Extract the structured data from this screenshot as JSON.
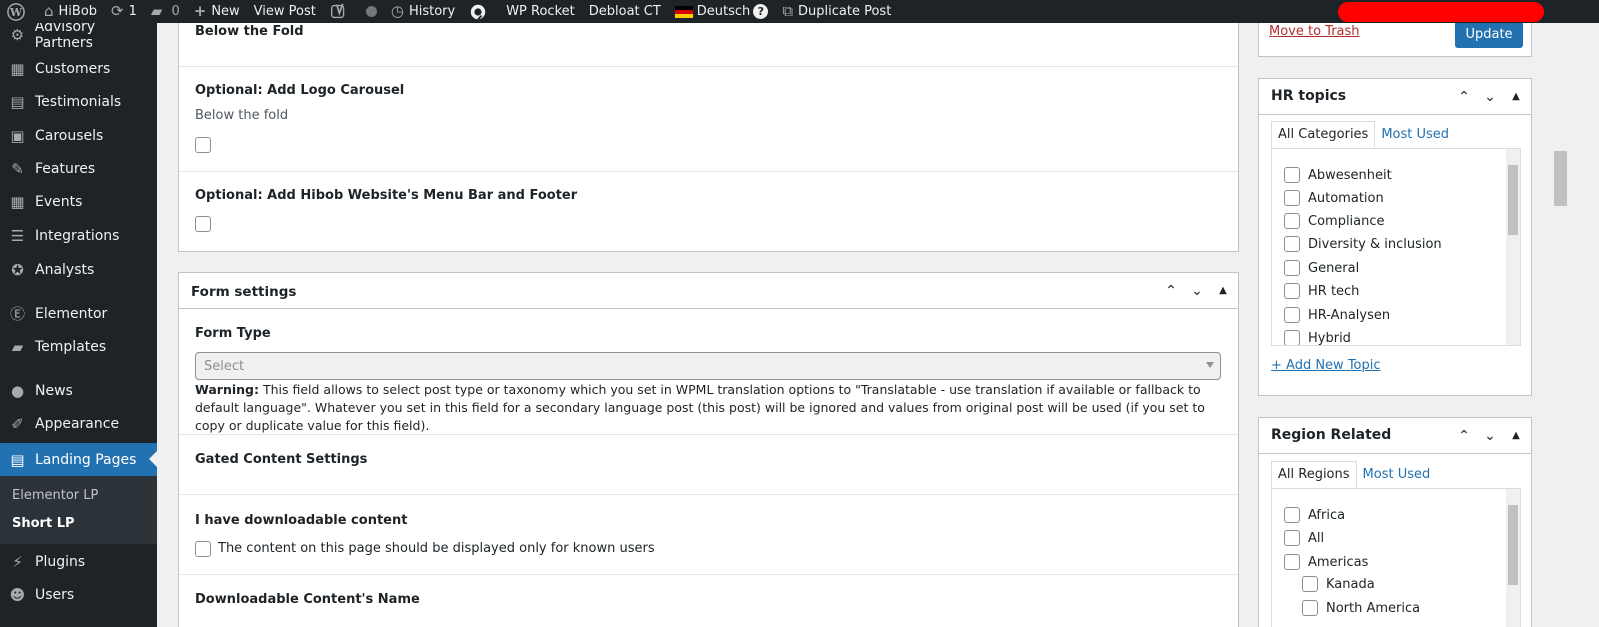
{
  "adminbar": {
    "site_name": "HiBob",
    "updates_count": "1",
    "comments_count": "0",
    "new_label": "New",
    "view_post": "View Post",
    "history": "History",
    "wp_rocket": "WP Rocket",
    "debloat": "Debloat CT",
    "language": "Deutsch",
    "help": "?",
    "duplicate": "Duplicate Post"
  },
  "sidebar": {
    "items": [
      {
        "label": "Advisory Partners",
        "icon": "gear-icon"
      },
      {
        "label": "Customers",
        "icon": "building-icon"
      },
      {
        "label": "Testimonials",
        "icon": "testimonial-icon"
      },
      {
        "label": "Carousels",
        "icon": "carousel-icon"
      },
      {
        "label": "Features",
        "icon": "pin-icon"
      },
      {
        "label": "Events",
        "icon": "calendar-icon"
      },
      {
        "label": "Integrations",
        "icon": "list-icon"
      },
      {
        "label": "Analysts",
        "icon": "award-icon"
      },
      {
        "label": "Elementor",
        "icon": "elementor-icon"
      },
      {
        "label": "Templates",
        "icon": "folder-icon"
      },
      {
        "label": "News",
        "icon": "globe-icon"
      },
      {
        "label": "Appearance",
        "icon": "brush-icon"
      },
      {
        "label": "Landing Pages",
        "icon": "table-icon"
      },
      {
        "label": "Plugins",
        "icon": "plug-icon"
      },
      {
        "label": "Users",
        "icon": "user-icon"
      }
    ],
    "submenu": [
      "Elementor LP",
      "Short LP"
    ]
  },
  "main": {
    "below_fold_title": "Below the Fold",
    "logo_carousel_label": "Optional: Add Logo Carousel",
    "logo_carousel_sub": "Below the fold",
    "menu_footer_label": "Optional: Add Hibob Website's Menu Bar and Footer",
    "form_settings": {
      "title": "Form settings",
      "form_type_label": "Form Type",
      "select_placeholder": "Select",
      "warning_bold": "Warning:",
      "warning_text": " This field allows to select post type or taxonomy which you set in WPML translation options to \"Translatable - use translation if available or fallback to default language\". Whatever you set in this field for a secondary language post (this post) will be ignored and values from original post will be used (if you set to copy or duplicate value for this field).",
      "gated_label": "Gated Content Settings",
      "downloadable_label": "I have downloadable content",
      "known_users_label": "The content on this page should be displayed only for known users",
      "content_name_label": "Downloadable Content's Name"
    }
  },
  "right": {
    "move_to_trash": "Move to Trash",
    "update": "Update",
    "hr_topics": {
      "title": "HR topics",
      "tab_all": "All Categories",
      "tab_most": "Most Used",
      "items": [
        "Abwesenheit",
        "Automation",
        "Compliance",
        "Diversity & inclusion",
        "General",
        "HR tech",
        "HR-Analysen",
        "Hybrid"
      ],
      "add_new": "+ Add New Topic"
    },
    "region": {
      "title": "Region Related",
      "tab_all": "All Regions",
      "tab_most": "Most Used",
      "items": [
        "Africa",
        "All",
        "Americas",
        "Kanada",
        "North America"
      ]
    }
  }
}
